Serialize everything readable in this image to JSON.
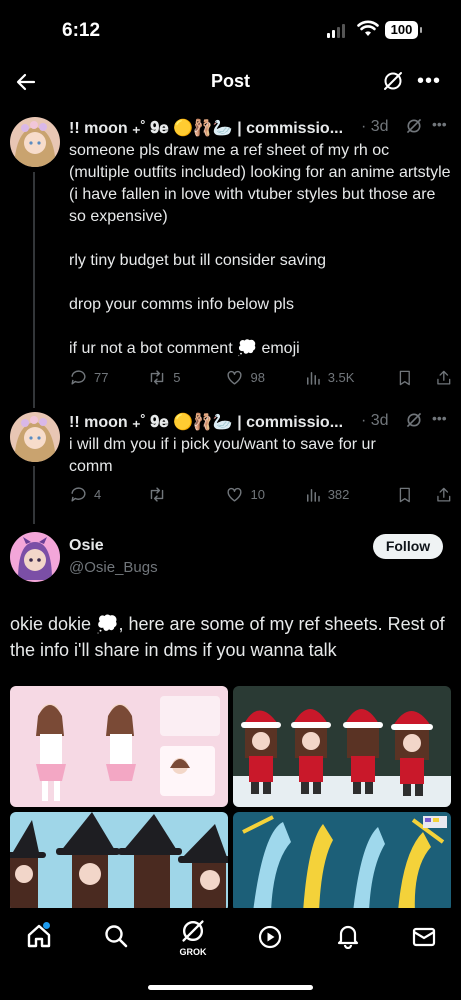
{
  "status_bar": {
    "time": "6:12",
    "battery": "100"
  },
  "header": {
    "title": "Post"
  },
  "tweets": [
    {
      "display_name": "!! moon ₊˚ 𝟗𝐞 🟡🩰🦢 | commissio...",
      "time": "· 3d",
      "text": "someone pls draw me a ref sheet of my rh oc (multiple outfits included) looking for an anime artstyle (i have fallen in love with vtuber styles but those are so expensive)\n\nrly tiny budget but ill consider saving\n\ndrop your comms info below pls\n\nif ur not a bot comment 💭 emoji",
      "replies": "77",
      "reposts": "5",
      "likes": "98",
      "views": "3.5K"
    },
    {
      "display_name": "!! moon ₊˚ 𝟗𝐞 🟡🩰🦢 | commissio...",
      "time": "· 3d",
      "text": "i will dm you if i pick you/want to save for ur comm",
      "replies": "4",
      "reposts": "",
      "likes": "10",
      "views": "382"
    }
  ],
  "reply": {
    "display_name": "Osie",
    "handle": "@Osie_Bugs",
    "follow_label": "Follow",
    "text": "okie dokie 💭, here are some of my ref sheets. Rest of the info i'll share in dms if you wanna talk",
    "images": [
      "ref-sheet-pink-outfit",
      "ref-sheet-santa-outfit",
      "ref-sheet-witch-outfit",
      "ref-sheet-blue-creature"
    ]
  },
  "nav": {
    "grok_label": "GROK"
  },
  "colors": {
    "background": "#000000",
    "muted": "#71767b",
    "text": "#e7e9ea",
    "accent": "#1d9bf0"
  },
  "icons": [
    "back-arrow-icon",
    "grok-icon",
    "more-icon",
    "reply-icon",
    "repost-icon",
    "like-icon",
    "views-icon",
    "bookmark-icon",
    "share-icon",
    "home-icon",
    "search-icon",
    "video-icon",
    "notifications-icon",
    "messages-icon"
  ]
}
